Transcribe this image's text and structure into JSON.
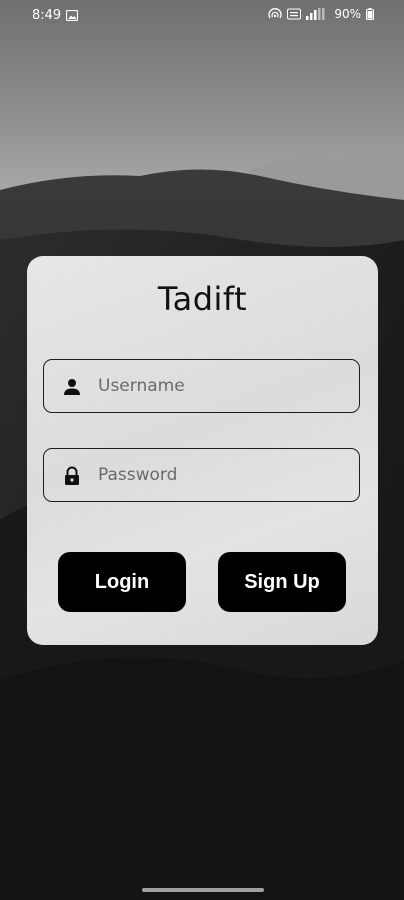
{
  "status_bar": {
    "time": "8:49",
    "battery": "90%",
    "icons": [
      "gallery-icon",
      "hotspot-icon",
      "volte-icon",
      "signal-icon",
      "battery-icon"
    ]
  },
  "app": {
    "title": "Tadift"
  },
  "form": {
    "username": {
      "icon": "person-icon",
      "placeholder": "Username",
      "value": ""
    },
    "password": {
      "icon": "lock-icon",
      "placeholder": "Password",
      "value": ""
    }
  },
  "buttons": {
    "login_label": "Login",
    "signup_label": "Sign Up"
  },
  "colors": {
    "card_background": "#e0e0e0",
    "button_background": "#000000",
    "button_text": "#ffffff",
    "page_background": "#161616"
  }
}
